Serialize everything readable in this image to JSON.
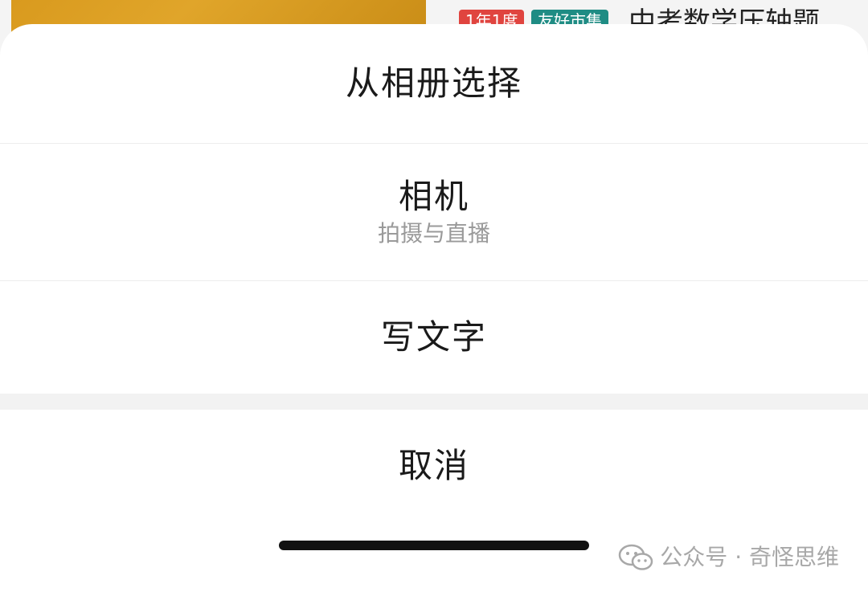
{
  "background": {
    "tags": [
      "1年1度",
      "友好市集"
    ],
    "title": "中考数学压轴题"
  },
  "action_sheet": {
    "options": [
      {
        "label": "从相册选择",
        "sublabel": ""
      },
      {
        "label": "相机",
        "sublabel": "拍摄与直播"
      },
      {
        "label": "写文字",
        "sublabel": ""
      }
    ],
    "cancel_label": "取消"
  },
  "watermark": {
    "text": "公众号 · 奇怪思维",
    "icon": "wechat-icon"
  },
  "colors": {
    "sheet_bg": "#ffffff",
    "text": "#1a1a1a",
    "subtext": "#9a9a9a",
    "tag_red": "#e0443f",
    "tag_teal": "#1f8c84",
    "thumb": "#d99a1e"
  }
}
